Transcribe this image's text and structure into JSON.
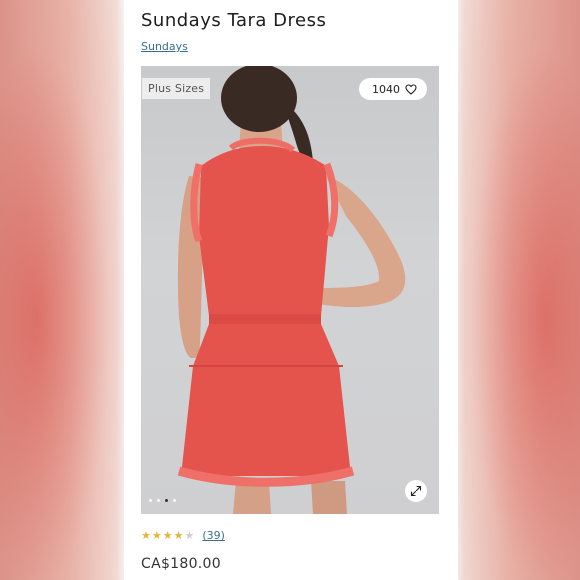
{
  "product": {
    "title": "Sundays Tara Dress",
    "brand": "Sundays",
    "badge": "Plus Sizes",
    "likes": "1040",
    "rating": 4,
    "rating_max": 5,
    "reviews": "(39)",
    "price": "CA$180.00"
  },
  "gallery": {
    "image_count": 4,
    "active_index": 2
  },
  "colors": {
    "link": "#3b6f8f",
    "star_filled": "#e5b53a",
    "star_empty": "#cfcfcf",
    "dress": "#e4544c"
  },
  "icons": {
    "like": "heart-icon",
    "expand": "expand-icon",
    "star": "star-icon"
  }
}
